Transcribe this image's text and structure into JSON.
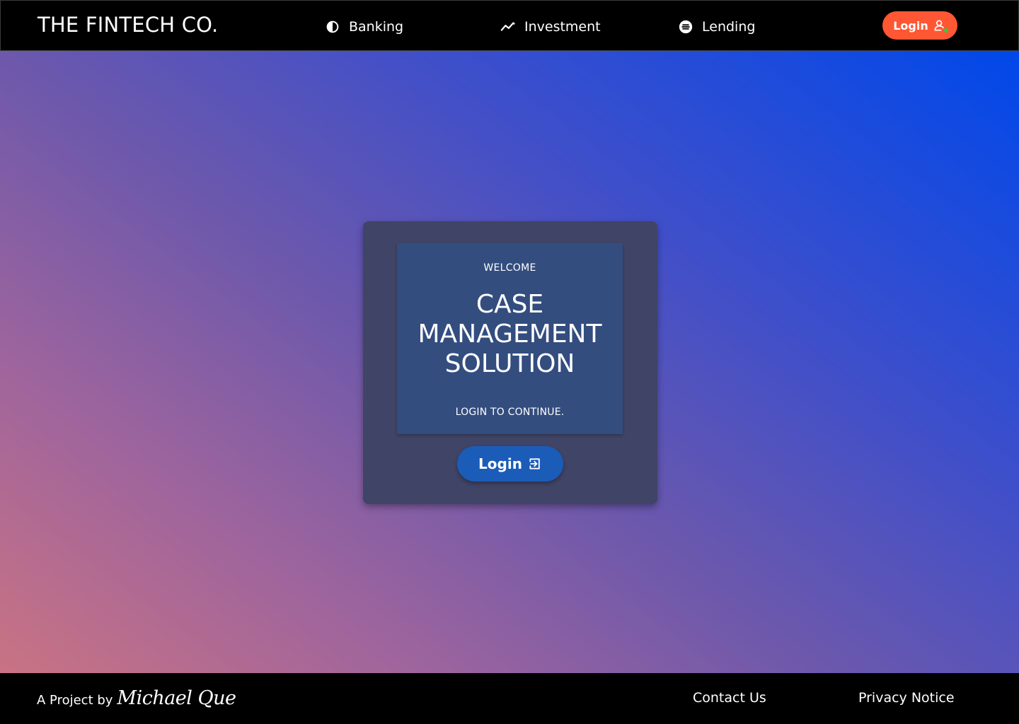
{
  "header": {
    "brand": "THE FINTECH CO.",
    "nav": [
      {
        "label": "Banking",
        "icon": "half-drop-icon"
      },
      {
        "label": "Investment",
        "icon": "trend-line-icon"
      },
      {
        "label": "Lending",
        "icon": "coin-icon"
      }
    ],
    "login_label": "Login",
    "login_icon": "user-online-icon",
    "login_color": "#ff5733"
  },
  "card": {
    "welcome": "WELCOME",
    "title_line1": "CASE",
    "title_line2": "MANAGEMENT",
    "title_line3": "SOLUTION",
    "subtitle": "LOGIN TO CONTINUE.",
    "login_label": "Login",
    "login_icon": "login-enter-icon",
    "login_color": "#1b5cb8"
  },
  "footer": {
    "credit_prefix": "A Project by",
    "signature": "Michael Que",
    "contact": "Contact Us",
    "privacy": "Privacy Notice"
  }
}
